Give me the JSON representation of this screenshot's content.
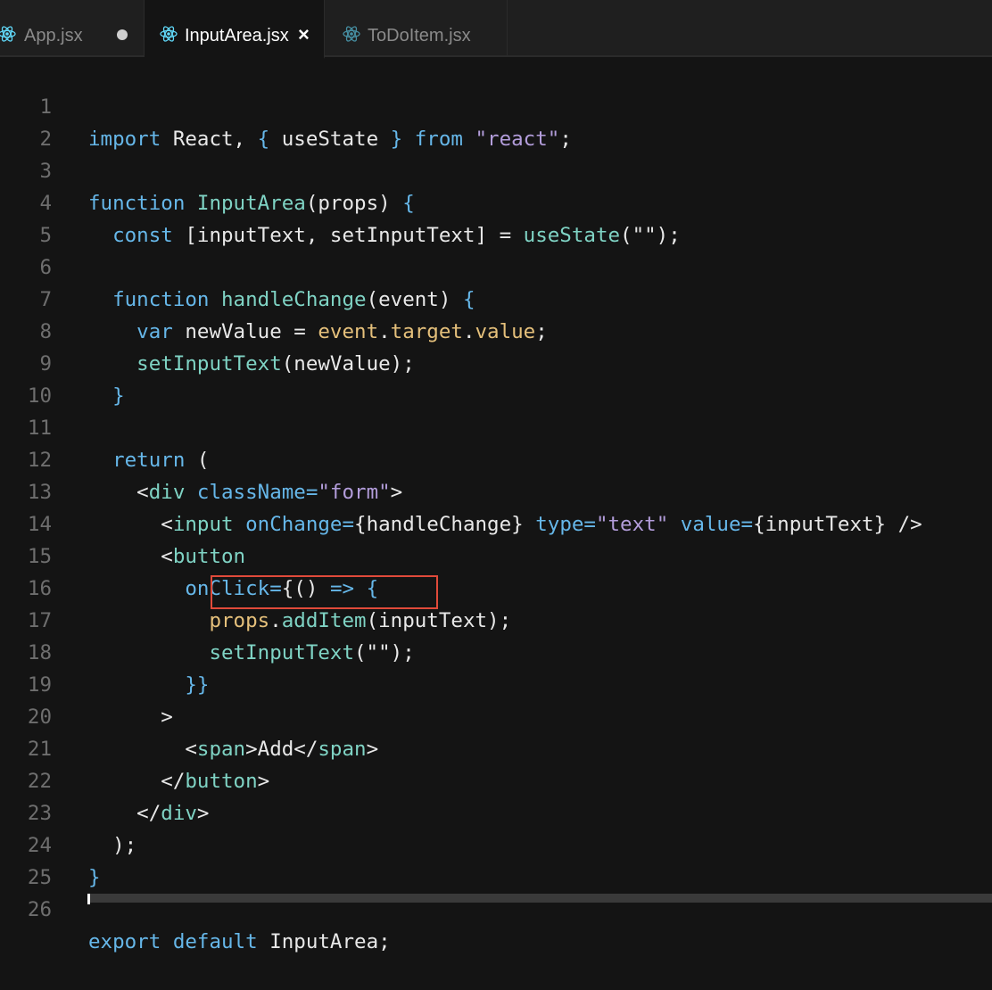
{
  "tabs": [
    {
      "label": "App.jsx",
      "modified": true
    },
    {
      "label": "InputArea.jsx",
      "active": true,
      "close": "×"
    },
    {
      "label": "ToDoItem.jsx"
    }
  ],
  "colors": {
    "keyword": "#66b7e9",
    "function": "#7fd3c4",
    "string": "#b39ddb",
    "property": "#e5c07b",
    "text": "#e8e8e8",
    "line_number": "#6e6e6e",
    "highlight_border": "#e04a3a",
    "react_icon": "#61dafb"
  },
  "code": {
    "line_numbers": [
      "1",
      "2",
      "3",
      "4",
      "5",
      "6",
      "7",
      "8",
      "9",
      "10",
      "11",
      "12",
      "13",
      "14",
      "15",
      "16",
      "17",
      "18",
      "19",
      "20",
      "21",
      "22",
      "23",
      "24",
      "25",
      "26"
    ],
    "l1": {
      "a": "import",
      "b": " React, ",
      "c": "{",
      "d": " useState ",
      "e": "}",
      "f": " from ",
      "g": "\"react\"",
      "h": ";"
    },
    "l3": {
      "a": "function",
      "b": " InputArea",
      "c": "(props) ",
      "d": "{"
    },
    "l4": {
      "a": "  const",
      "b": " [inputText, setInputText] = ",
      "c": "useState",
      "d": "(\"\");"
    },
    "l6": {
      "a": "  function",
      "b": " handleChange",
      "c": "(event) ",
      "d": "{"
    },
    "l7": {
      "a": "    var",
      "b": " newValue = ",
      "c": "event",
      "d": ".",
      "e": "target",
      "f": ".",
      "g": "value",
      "h": ";"
    },
    "l8": {
      "a": "    setInputText",
      "b": "(newValue);"
    },
    "l9": {
      "a": "  }"
    },
    "l11": {
      "a": "  return",
      "b": " ("
    },
    "l12": {
      "a": "    <",
      "b": "div",
      "c": " className",
      "d": "=",
      "e": "\"form\"",
      "f": ">"
    },
    "l13": {
      "a": "      <",
      "b": "input",
      "c": " onChange",
      "d": "=",
      "e": "{handleChange}",
      "f": " type",
      "g": "=",
      "h": "\"text\"",
      "i": " value",
      "j": "=",
      "k": "{inputText}",
      "l": " />"
    },
    "l14": {
      "a": "      <",
      "b": "button"
    },
    "l15": {
      "a": "        onClick",
      "b": "=",
      "c": "{() ",
      "d": "=>",
      "e": " {"
    },
    "l16": {
      "a": "          props",
      "b": ".",
      "c": "addItem",
      "d": "(inputText);"
    },
    "l17": {
      "a": "          setInputText",
      "b": "(\"\");"
    },
    "l18": {
      "a": "        }}"
    },
    "l19": {
      "a": "      >"
    },
    "l20": {
      "a": "        <",
      "b": "span",
      "c": ">Add</",
      "d": "span",
      "e": ">"
    },
    "l21": {
      "a": "      </",
      "b": "button",
      "c": ">"
    },
    "l22": {
      "a": "    </",
      "b": "div",
      "c": ">"
    },
    "l23": {
      "a": "  );"
    },
    "l24": {
      "a": "}"
    },
    "l26": {
      "a": "export",
      "b": " default",
      "c": " InputArea;"
    }
  }
}
